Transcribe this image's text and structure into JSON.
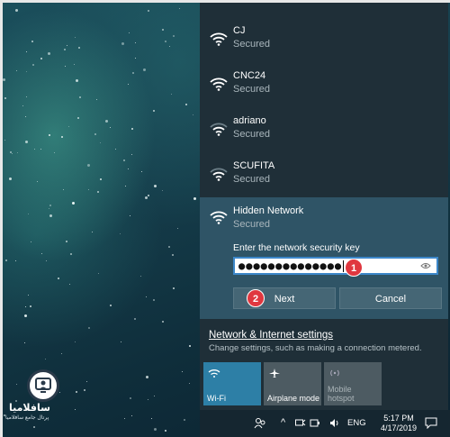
{
  "networks": [
    {
      "name": "CJ",
      "status": "Secured"
    },
    {
      "name": "CNC24",
      "status": "Secured"
    },
    {
      "name": "adriano",
      "status": "Secured"
    },
    {
      "name": "SCUFITA",
      "status": "Secured"
    }
  ],
  "expanded_network": {
    "name": "Hidden Network",
    "status": "Secured",
    "key_label": "Enter the network security key",
    "key_value": "●●●●●●●●●●●●●●",
    "next_label": "Next",
    "cancel_label": "Cancel",
    "step_badges": [
      "1",
      "2"
    ]
  },
  "settings": {
    "link": "Network & Internet settings",
    "sub": "Change settings, such as making a connection metered."
  },
  "tiles": [
    {
      "label": "Wi-Fi",
      "icon": "wifi-icon",
      "active": true
    },
    {
      "label": "Airplane mode",
      "icon": "airplane-icon",
      "active": false
    },
    {
      "label": "Mobile hotspot",
      "icon": "hotspot-icon",
      "active": false
    }
  ],
  "taskbar": {
    "language": "ENG",
    "time": "5:17 PM",
    "date": "4/17/2019"
  },
  "watermark": {
    "title": "سافلامیا",
    "subtitle": "پرتال جامع سافلامیا"
  },
  "colors": {
    "flyout_bg": "#1f2f38",
    "expanded_bg": "#2f5466",
    "accent": "#3c87c9",
    "badge": "#e0373f",
    "active_tile": "#2d7fa6"
  }
}
